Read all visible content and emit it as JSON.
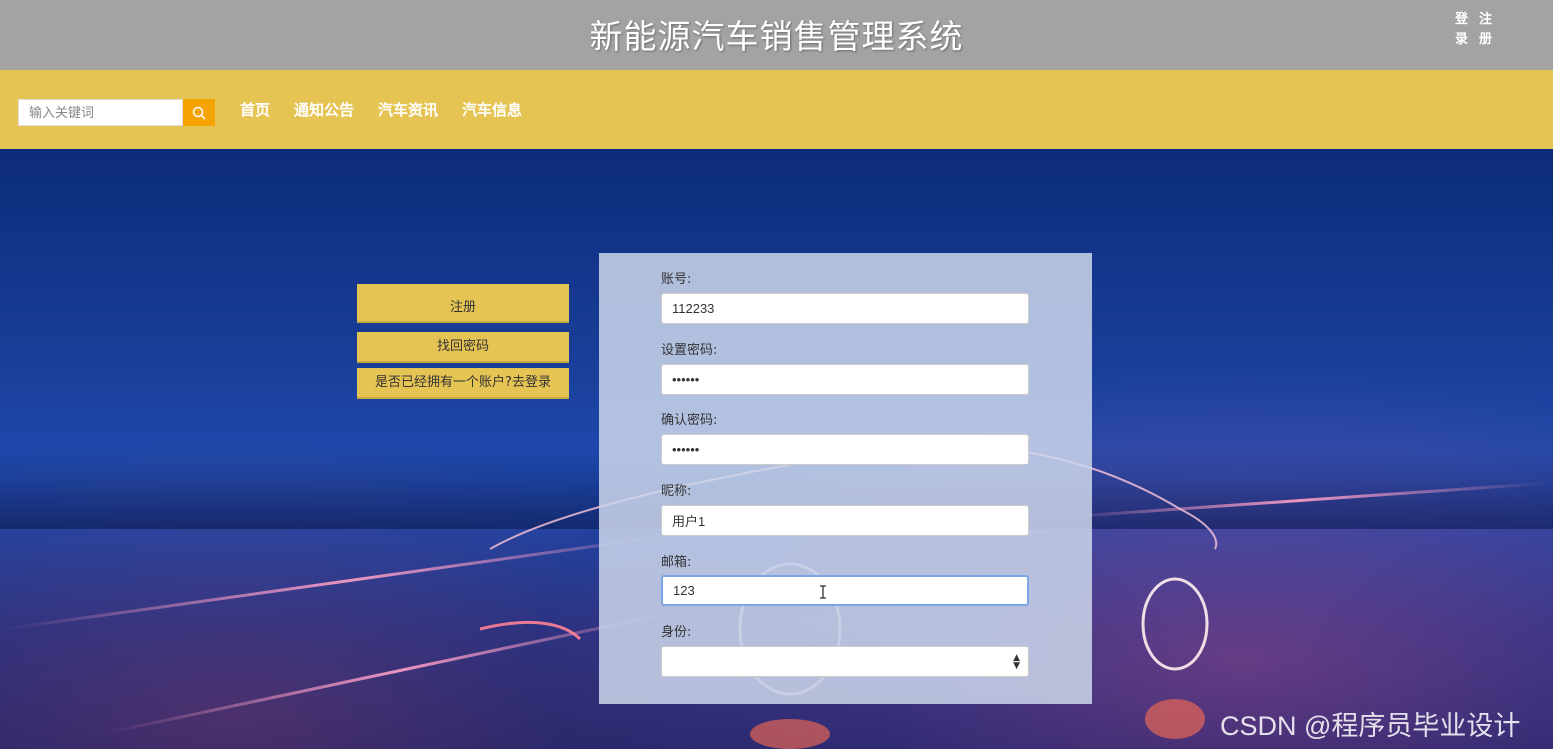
{
  "header": {
    "site_title": "新能源汽车销售管理系统",
    "auth_links": [
      "登录",
      "注册"
    ]
  },
  "nav": {
    "search_placeholder": "输入关键词",
    "items": [
      "首页",
      "通知公告",
      "汽车资讯",
      "汽车信息"
    ]
  },
  "side_buttons": {
    "register": "注册",
    "forgot_password": "找回密码",
    "have_account": "是否已经拥有一个账户?去登录"
  },
  "form": {
    "account_label": "账号:",
    "account_value": "112233",
    "password_label": "设置密码:",
    "password_value": "••••••",
    "confirm_label": "确认密码:",
    "confirm_value": "••••••",
    "nickname_label": "昵称:",
    "nickname_value": "用户1",
    "email_label": "邮箱:",
    "email_value": "123",
    "identity_label": "身份:",
    "identity_value": ""
  },
  "watermark": "CSDN @程序员毕业设计",
  "colors": {
    "topbar": "#a3a3a3",
    "navbar": "#e5c454",
    "search_button": "#f5a300",
    "panel": "#cdd7eb"
  },
  "icons": {
    "search": "search-icon",
    "select_arrows": "select-arrows-icon",
    "cursor": "text-cursor-icon"
  }
}
